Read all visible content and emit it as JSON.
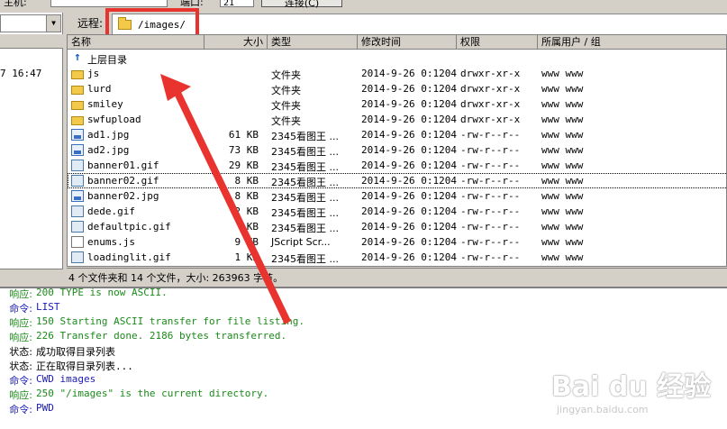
{
  "connection": {
    "host_label": "主机:",
    "port_label": "端口:",
    "port_value": "21",
    "connect_button": "连接(C)"
  },
  "local": {
    "time_fragment": "7 16:47"
  },
  "remote": {
    "label": "远程:",
    "path": "/images/",
    "columns": [
      "名称",
      "大小",
      "类型",
      "修改时间",
      "权限",
      "所属用户 / 组"
    ],
    "up_dir": "上层目录",
    "rows": [
      {
        "name": "js",
        "size": "",
        "type": "文件夹",
        "date": "2014-9-26 0:1204",
        "perm": "drwxr-xr-x",
        "owner": "www www",
        "icon": "folder-icon"
      },
      {
        "name": "lurd",
        "size": "",
        "type": "文件夹",
        "date": "2014-9-26 0:1204",
        "perm": "drwxr-xr-x",
        "owner": "www www",
        "icon": "folder-icon"
      },
      {
        "name": "smiley",
        "size": "",
        "type": "文件夹",
        "date": "2014-9-26 0:1204",
        "perm": "drwxr-xr-x",
        "owner": "www www",
        "icon": "folder-icon"
      },
      {
        "name": "swfupload",
        "size": "",
        "type": "文件夹",
        "date": "2014-9-26 0:1204",
        "perm": "drwxr-xr-x",
        "owner": "www www",
        "icon": "folder-icon"
      },
      {
        "name": "ad1.jpg",
        "size": "61 KB",
        "type": "2345看图王 ...",
        "date": "2014-9-26 0:1204",
        "perm": "-rw-r--r--",
        "owner": "www www",
        "icon": "jpg-icon"
      },
      {
        "name": "ad2.jpg",
        "size": "73 KB",
        "type": "2345看图王 ...",
        "date": "2014-9-26 0:1204",
        "perm": "-rw-r--r--",
        "owner": "www www",
        "icon": "jpg-icon"
      },
      {
        "name": "banner01.gif",
        "size": "29 KB",
        "type": "2345看图王 ...",
        "date": "2014-9-26 0:1204",
        "perm": "-rw-r--r--",
        "owner": "www www",
        "icon": "gif-icon"
      },
      {
        "name": "banner02.gif",
        "size": "8 KB",
        "type": "2345看图王 ...",
        "date": "2014-9-26 0:1204",
        "perm": "-rw-r--r--",
        "owner": "www www",
        "icon": "gif-icon"
      },
      {
        "name": "banner02.jpg",
        "size": "8 KB",
        "type": "2345看图王 ...",
        "date": "2014-9-26 0:1204",
        "perm": "-rw-r--r--",
        "owner": "www www",
        "icon": "jpg-icon"
      },
      {
        "name": "dede.gif",
        "size": "2 KB",
        "type": "2345看图王 ...",
        "date": "2014-9-26 0:1204",
        "perm": "-rw-r--r--",
        "owner": "www www",
        "icon": "gif-icon"
      },
      {
        "name": "defaultpic.gif",
        "size": "KB",
        "type": "2345看图王 ...",
        "date": "2014-9-26 0:1204",
        "perm": "-rw-r--r--",
        "owner": "www www",
        "icon": "gif-icon"
      },
      {
        "name": "enums.js",
        "size": "9 KB",
        "type": "JScript Scr...",
        "date": "2014-9-26 0:1204",
        "perm": "-rw-r--r--",
        "owner": "www www",
        "icon": "script-icon"
      },
      {
        "name": "loadinglit.gif",
        "size": "1 KB",
        "type": "2345看图王 ...",
        "date": "2014-9-26 0:1204",
        "perm": "-rw-r--r--",
        "owner": "www www",
        "icon": "gif-icon"
      }
    ],
    "status": "4 个文件夹和 14 个文件，大小: 263963 字节。"
  },
  "log": [
    {
      "key": "响应:",
      "msg": "200 TYPE is now ASCII.",
      "color": "#1c8a1c"
    },
    {
      "key": "命令:",
      "msg": "LIST",
      "color": "#1a1ab8"
    },
    {
      "key": "响应:",
      "msg": "150 Starting ASCII transfer for file listing.",
      "color": "#1c8a1c"
    },
    {
      "key": "响应:",
      "msg": "226 Transfer done. 2186 bytes transferred.",
      "color": "#1c8a1c"
    },
    {
      "key": "状态:",
      "msg": "成功取得目录列表",
      "color": "#000000"
    },
    {
      "key": "状态:",
      "msg": "正在取得目录列表...",
      "color": "#000000"
    },
    {
      "key": "命令:",
      "msg": "CWD images",
      "color": "#1a1ab8"
    },
    {
      "key": "响应:",
      "msg": "250 \"/images\" is the current directory.",
      "color": "#1c8a1c"
    },
    {
      "key": "命令:",
      "msg": "PWD",
      "color": "#1a1ab8"
    }
  ],
  "watermark": {
    "brand": "Bai du 经验",
    "url": "jingyan.baidu.com"
  },
  "colors": {
    "highlight_red": "#e8332f",
    "log_green": "#1c8a1c",
    "log_blue": "#1a1ab8"
  }
}
